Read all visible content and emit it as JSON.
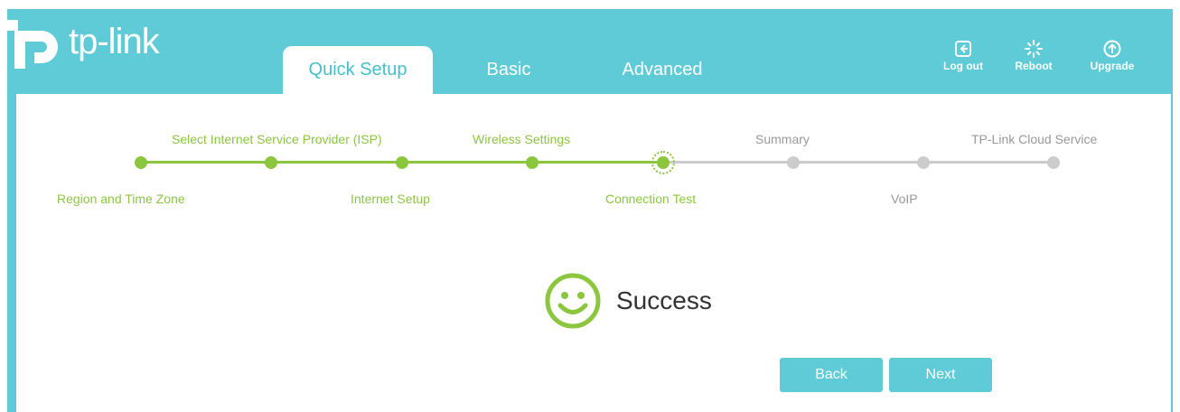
{
  "header": {
    "brand": "tp-link",
    "tabs": [
      {
        "label": "Quick Setup",
        "active": true
      },
      {
        "label": "Basic",
        "active": false
      },
      {
        "label": "Advanced",
        "active": false
      }
    ],
    "tools": [
      {
        "label": "Log out",
        "icon": "logout-icon"
      },
      {
        "label": "Reboot",
        "icon": "reboot-icon"
      },
      {
        "label": "Upgrade",
        "icon": "upgrade-icon"
      }
    ]
  },
  "wizard": {
    "steps": [
      {
        "label": "Region and Time Zone",
        "state": "done"
      },
      {
        "label": "Select Internet Service Provider (ISP)",
        "state": "done"
      },
      {
        "label": "Internet Setup",
        "state": "done"
      },
      {
        "label": "Wireless Settings",
        "state": "done"
      },
      {
        "label": "Connection Test",
        "state": "current"
      },
      {
        "label": "Summary",
        "state": "pending"
      },
      {
        "label": "VoIP",
        "state": "pending"
      },
      {
        "label": "TP-Link Cloud Service",
        "state": "pending"
      }
    ]
  },
  "result": {
    "icon": "smiley-icon",
    "text": "Success"
  },
  "buttons": {
    "back": "Back",
    "next": "Next"
  },
  "colors": {
    "header": "#5ecbd6",
    "active_tab_text": "#48bfcb",
    "progress_done": "#8cc63f",
    "progress_pending": "#cccccc",
    "button": "#5ecbd6"
  }
}
